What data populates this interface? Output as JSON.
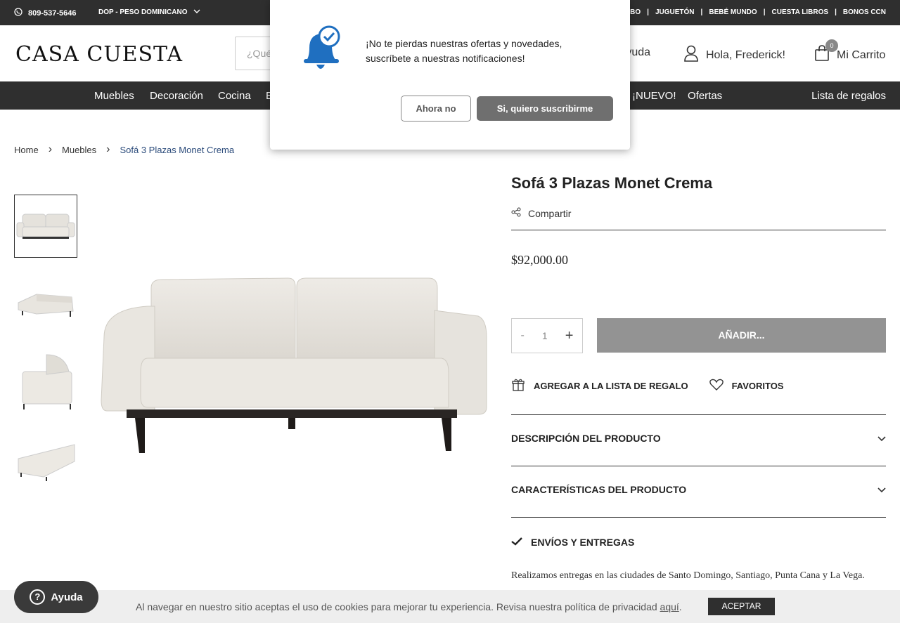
{
  "topbar": {
    "phone": "809-537-5646",
    "currency": "DOP - PESO DOMINICANO",
    "links": [
      "MBO",
      "JUGUETÓN",
      "BEBÉ MUNDO",
      "CUESTA LIBROS",
      "BONOS CCN"
    ]
  },
  "header": {
    "logo": "CASA CUESTA",
    "search_placeholder": "¿Qué",
    "help": "Ayuda",
    "greeting": "Hola, Frederick!",
    "cart_label": "Mi Carrito",
    "cart_count": "0"
  },
  "nav": {
    "items": [
      "Muebles",
      "Decoración",
      "Cocina",
      "E",
      "¡NUEVO!",
      "Ofertas"
    ],
    "gift_list": "Lista de regalos"
  },
  "breadcrumb": [
    "Home",
    "Muebles",
    "Sofá 3 Plazas Monet Crema"
  ],
  "product": {
    "title": "Sofá 3 Plazas Monet Crema",
    "share": "Compartir",
    "price": "$92,000.00",
    "qty_minus": "-",
    "qty": "1",
    "qty_plus": "+",
    "add_button": "AÑADIR...",
    "gift_registry": "AGREGAR A LA LISTA DE REGALO",
    "favorites": "FAVORITOS",
    "desc_title": "DESCRIPCIÓN DEL PRODUCTO",
    "features_title": "CARACTERÍSTICAS DEL PRODUCTO",
    "shipping_title": "ENVÍOS Y ENTREGAS",
    "shipping_text": "Realizamos entregas en las ciudades de Santo Domingo, Santiago, Punta Cana y La Vega."
  },
  "cookie": {
    "text": "Al navegar en nuestro sitio aceptas el uso de cookies para mejorar tu experiencia. Revisa nuestra política de privacidad ",
    "link": "aquí",
    "end": ".",
    "accept": "ACEPTAR"
  },
  "help_button": "Ayuda",
  "modal": {
    "message": "¡No te pierdas nuestras ofertas y novedades, suscríbete a nuestras notificaciones!",
    "no": "Ahora no",
    "yes": "Si, quiero suscribirme"
  }
}
